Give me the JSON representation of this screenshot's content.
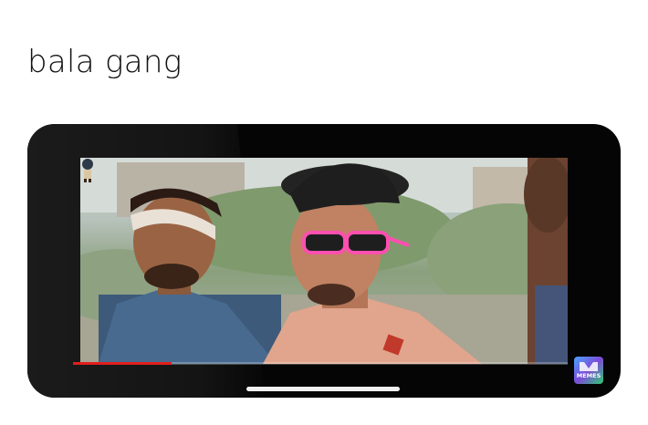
{
  "post": {
    "caption": "bala gang"
  },
  "video": {
    "progress_fraction": 0.2,
    "progress_color": "#e01e1e",
    "watermark_text": "MEMES",
    "watermark_colors": [
      "#3a7bd5",
      "#8e44ad",
      "#2ecc71"
    ]
  }
}
